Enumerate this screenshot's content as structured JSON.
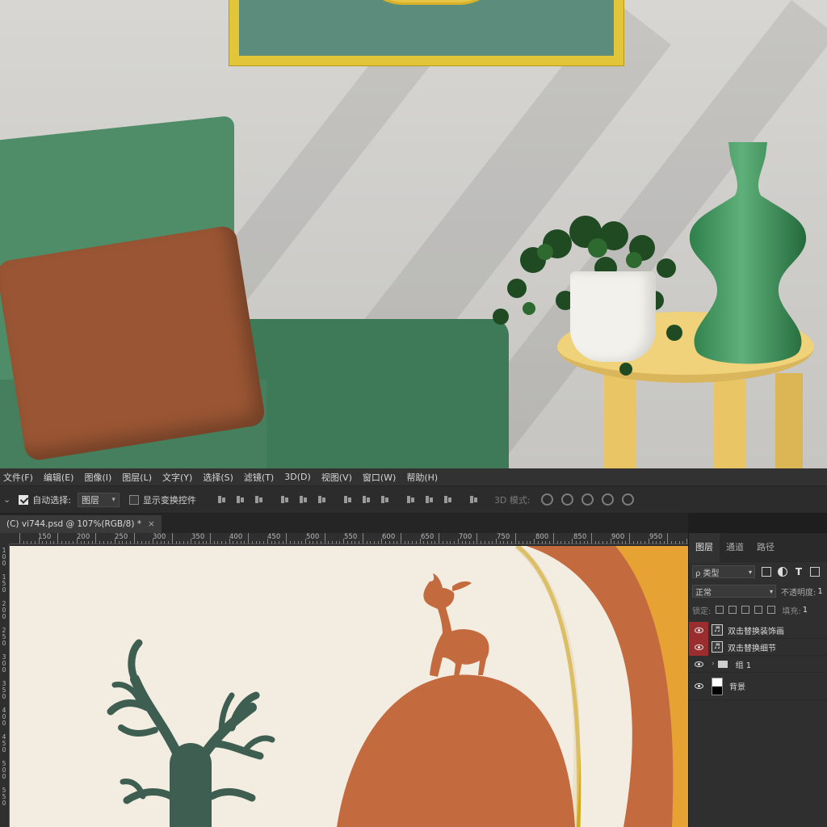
{
  "menubar": {
    "items": [
      "文件(F)",
      "编辑(E)",
      "图像(I)",
      "图层(L)",
      "文字(Y)",
      "选择(S)",
      "滤镜(T)",
      "3D(D)",
      "视图(V)",
      "窗口(W)",
      "帮助(H)"
    ]
  },
  "options": {
    "auto_select_label": "自动选择:",
    "auto_select_value": "图层",
    "show_transform_label": "显示变换控件",
    "mode_3d_label": "3D 模式:"
  },
  "document": {
    "tab_label": "(C) vi744.psd @ 107%(RGB/8) *",
    "close_glyph": "×"
  },
  "ruler": {
    "h_ticks": [
      "150",
      "200",
      "250",
      "300",
      "350",
      "400",
      "450",
      "500",
      "550",
      "600",
      "650",
      "700",
      "750",
      "800",
      "850",
      "900",
      "950"
    ],
    "v_digits": [
      "1",
      "0",
      "0",
      "1",
      "5",
      "0",
      "2",
      "0",
      "0",
      "2",
      "5",
      "0",
      "3",
      "0",
      "0",
      "3",
      "5",
      "0",
      "4",
      "0",
      "0",
      "4",
      "5",
      "0",
      "5",
      "0",
      "0",
      "5",
      "5",
      "0"
    ]
  },
  "layers_panel": {
    "tabs": [
      "图层",
      "通道",
      "路径"
    ],
    "filter_label": "ρ 类型",
    "blend_mode": "正常",
    "opacity_label": "不透明度:",
    "opacity_value": "1",
    "lock_label": "锁定:",
    "fill_label": "填充:",
    "fill_value": "1",
    "layers": [
      {
        "name": "双击替换装饰画",
        "highlight": true
      },
      {
        "name": "双击替换细节",
        "highlight": true
      },
      {
        "name": "组 1",
        "highlight": false
      },
      {
        "name": "背景",
        "highlight": false
      }
    ]
  },
  "colors": {
    "artboard_bg": "#f3ede1",
    "terracotta": "#c46a3f",
    "orange": "#e6a233",
    "gold": "#d4a818",
    "tree": "#3e5e52",
    "sofa": "#4f8c68",
    "highlight_red": "#9a2e2e"
  }
}
